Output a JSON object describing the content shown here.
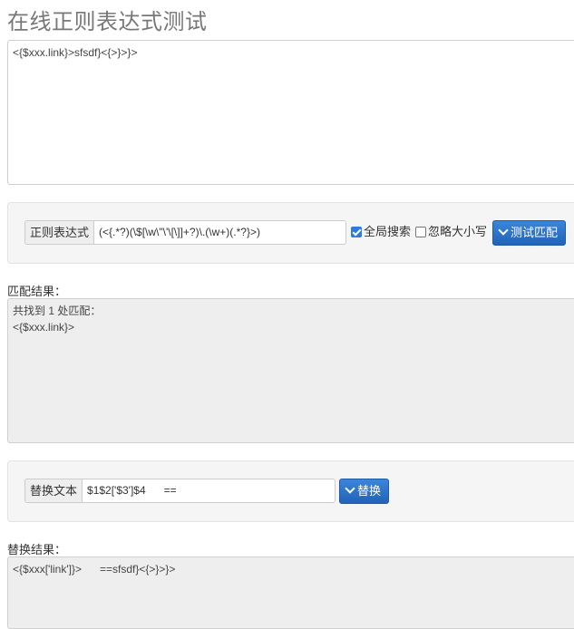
{
  "page": {
    "title": "在线正则表达式测试"
  },
  "source": {
    "text": "<{$xxx.link}>sfsdf}<{>}>}>"
  },
  "regex_panel": {
    "label": "正则表达式",
    "pattern": "(<{.*?)(\\$[\\w\\\"\\'\\[\\]]+?)\\.(\\w+)(.*?}>)",
    "global_label": "全局搜索",
    "global_checked": true,
    "ignorecase_label": "忽略大小写",
    "ignorecase_checked": false,
    "test_button": "测试匹配"
  },
  "match_section": {
    "label": "匹配结果：",
    "result_text": "共找到 1 处匹配：\n<{$xxx.link}>"
  },
  "replace_panel": {
    "label": "替换文本",
    "replacement": "$1$2['$3']$4      ==",
    "replace_button": "替换"
  },
  "replace_section": {
    "label": "替换结果：",
    "result_text": "<{$xxx['link']}>      ==sfsdf}<{>}>}>"
  },
  "colors": {
    "primary_button": "#2f6fcc",
    "checkbox_checked": "#2f7ae0",
    "result_bg": "#eeeeee",
    "panel_bg": "#f5f5f5"
  }
}
